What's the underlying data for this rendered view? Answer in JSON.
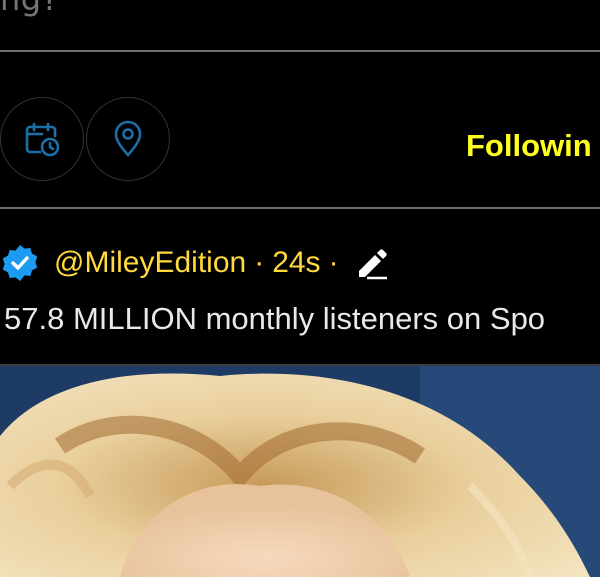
{
  "composer": {
    "placeholder_tail": "ng?"
  },
  "toolbar": {
    "schedule_icon": "calendar-clock-icon",
    "location_icon": "location-pin-icon",
    "following_label": "Followin"
  },
  "post": {
    "verified_icon": "verified-badge-icon",
    "handle": "@MileyEdition",
    "separator": "·",
    "time": "24s",
    "edit_icon": "edit-pencil-icon",
    "text": "57.8 MILLION monthly listeners on Spo"
  },
  "media": {
    "image_subject": "photo of blonde hair on blue background"
  },
  "colors": {
    "background": "#000000",
    "accent_yellow": "#ffff1f",
    "handle_yellow": "#ffd93d",
    "icon_blue": "#1d9bf0",
    "divider": "#6a6e72"
  }
}
